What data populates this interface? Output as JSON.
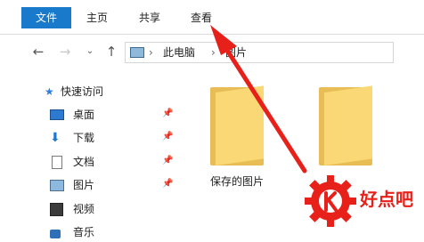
{
  "ribbon": {
    "tabs": [
      {
        "label": "文件",
        "active": true
      },
      {
        "label": "主页"
      },
      {
        "label": "共享"
      },
      {
        "label": "查看"
      }
    ]
  },
  "address_bar": {
    "segments": [
      "此电脑",
      "图片"
    ]
  },
  "sidebar": {
    "quick_access": "快速访问",
    "items": [
      {
        "label": "桌面",
        "pinned": true,
        "icon": "desktop-icon"
      },
      {
        "label": "下载",
        "pinned": true,
        "icon": "download-icon"
      },
      {
        "label": "文档",
        "pinned": true,
        "icon": "documents-icon"
      },
      {
        "label": "图片",
        "pinned": true,
        "icon": "pictures-icon"
      },
      {
        "label": "视频",
        "pinned": false,
        "icon": "videos-icon"
      },
      {
        "label": "音乐",
        "pinned": false,
        "icon": "music-icon"
      }
    ]
  },
  "content": {
    "folders": [
      {
        "label": "保存的图片"
      },
      {
        "label": ""
      }
    ]
  },
  "watermark": {
    "text": "好点吧"
  },
  "colors": {
    "file_tab": "#1979ca",
    "folder": "#f9d875",
    "arrow": "#e8201a"
  }
}
